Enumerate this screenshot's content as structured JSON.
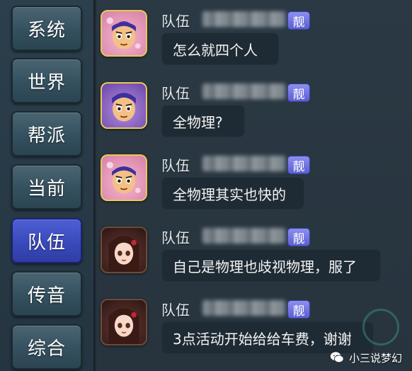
{
  "sidebar": {
    "tabs": [
      {
        "label": "系统",
        "active": false
      },
      {
        "label": "世界",
        "active": false
      },
      {
        "label": "帮派",
        "active": false
      },
      {
        "label": "当前",
        "active": false
      },
      {
        "label": "队伍",
        "active": true
      },
      {
        "label": "传音",
        "active": false
      },
      {
        "label": "综合",
        "active": false
      }
    ]
  },
  "messages": [
    {
      "channel": "队伍",
      "badge": "靓",
      "text": "怎么就四个人",
      "avatar_icon": "boy-hero-pink-avatar-icon"
    },
    {
      "channel": "队伍",
      "badge": "靓",
      "text": "全物理?",
      "avatar_icon": "boy-hero-purple-avatar-icon"
    },
    {
      "channel": "队伍",
      "badge": "靓",
      "text": "全物理其实也快的",
      "avatar_icon": "boy-hero-pink-avatar-icon"
    },
    {
      "channel": "队伍",
      "badge": "靓",
      "text": "自己是物理也歧视物理，服了",
      "avatar_icon": "girl-hero-avatar-icon"
    },
    {
      "channel": "队伍",
      "badge": "靓",
      "text": "3点活动开始给给车费，谢谢",
      "avatar_icon": "girl-hero-avatar-icon"
    }
  ],
  "watermark": {
    "text": "小三说梦幻",
    "icon": "wechat-icon"
  },
  "colors": {
    "active_tab": "#3848b8",
    "tab": "#34505e",
    "badge": "#6a6ee0",
    "bubble": "#1f2b34"
  }
}
